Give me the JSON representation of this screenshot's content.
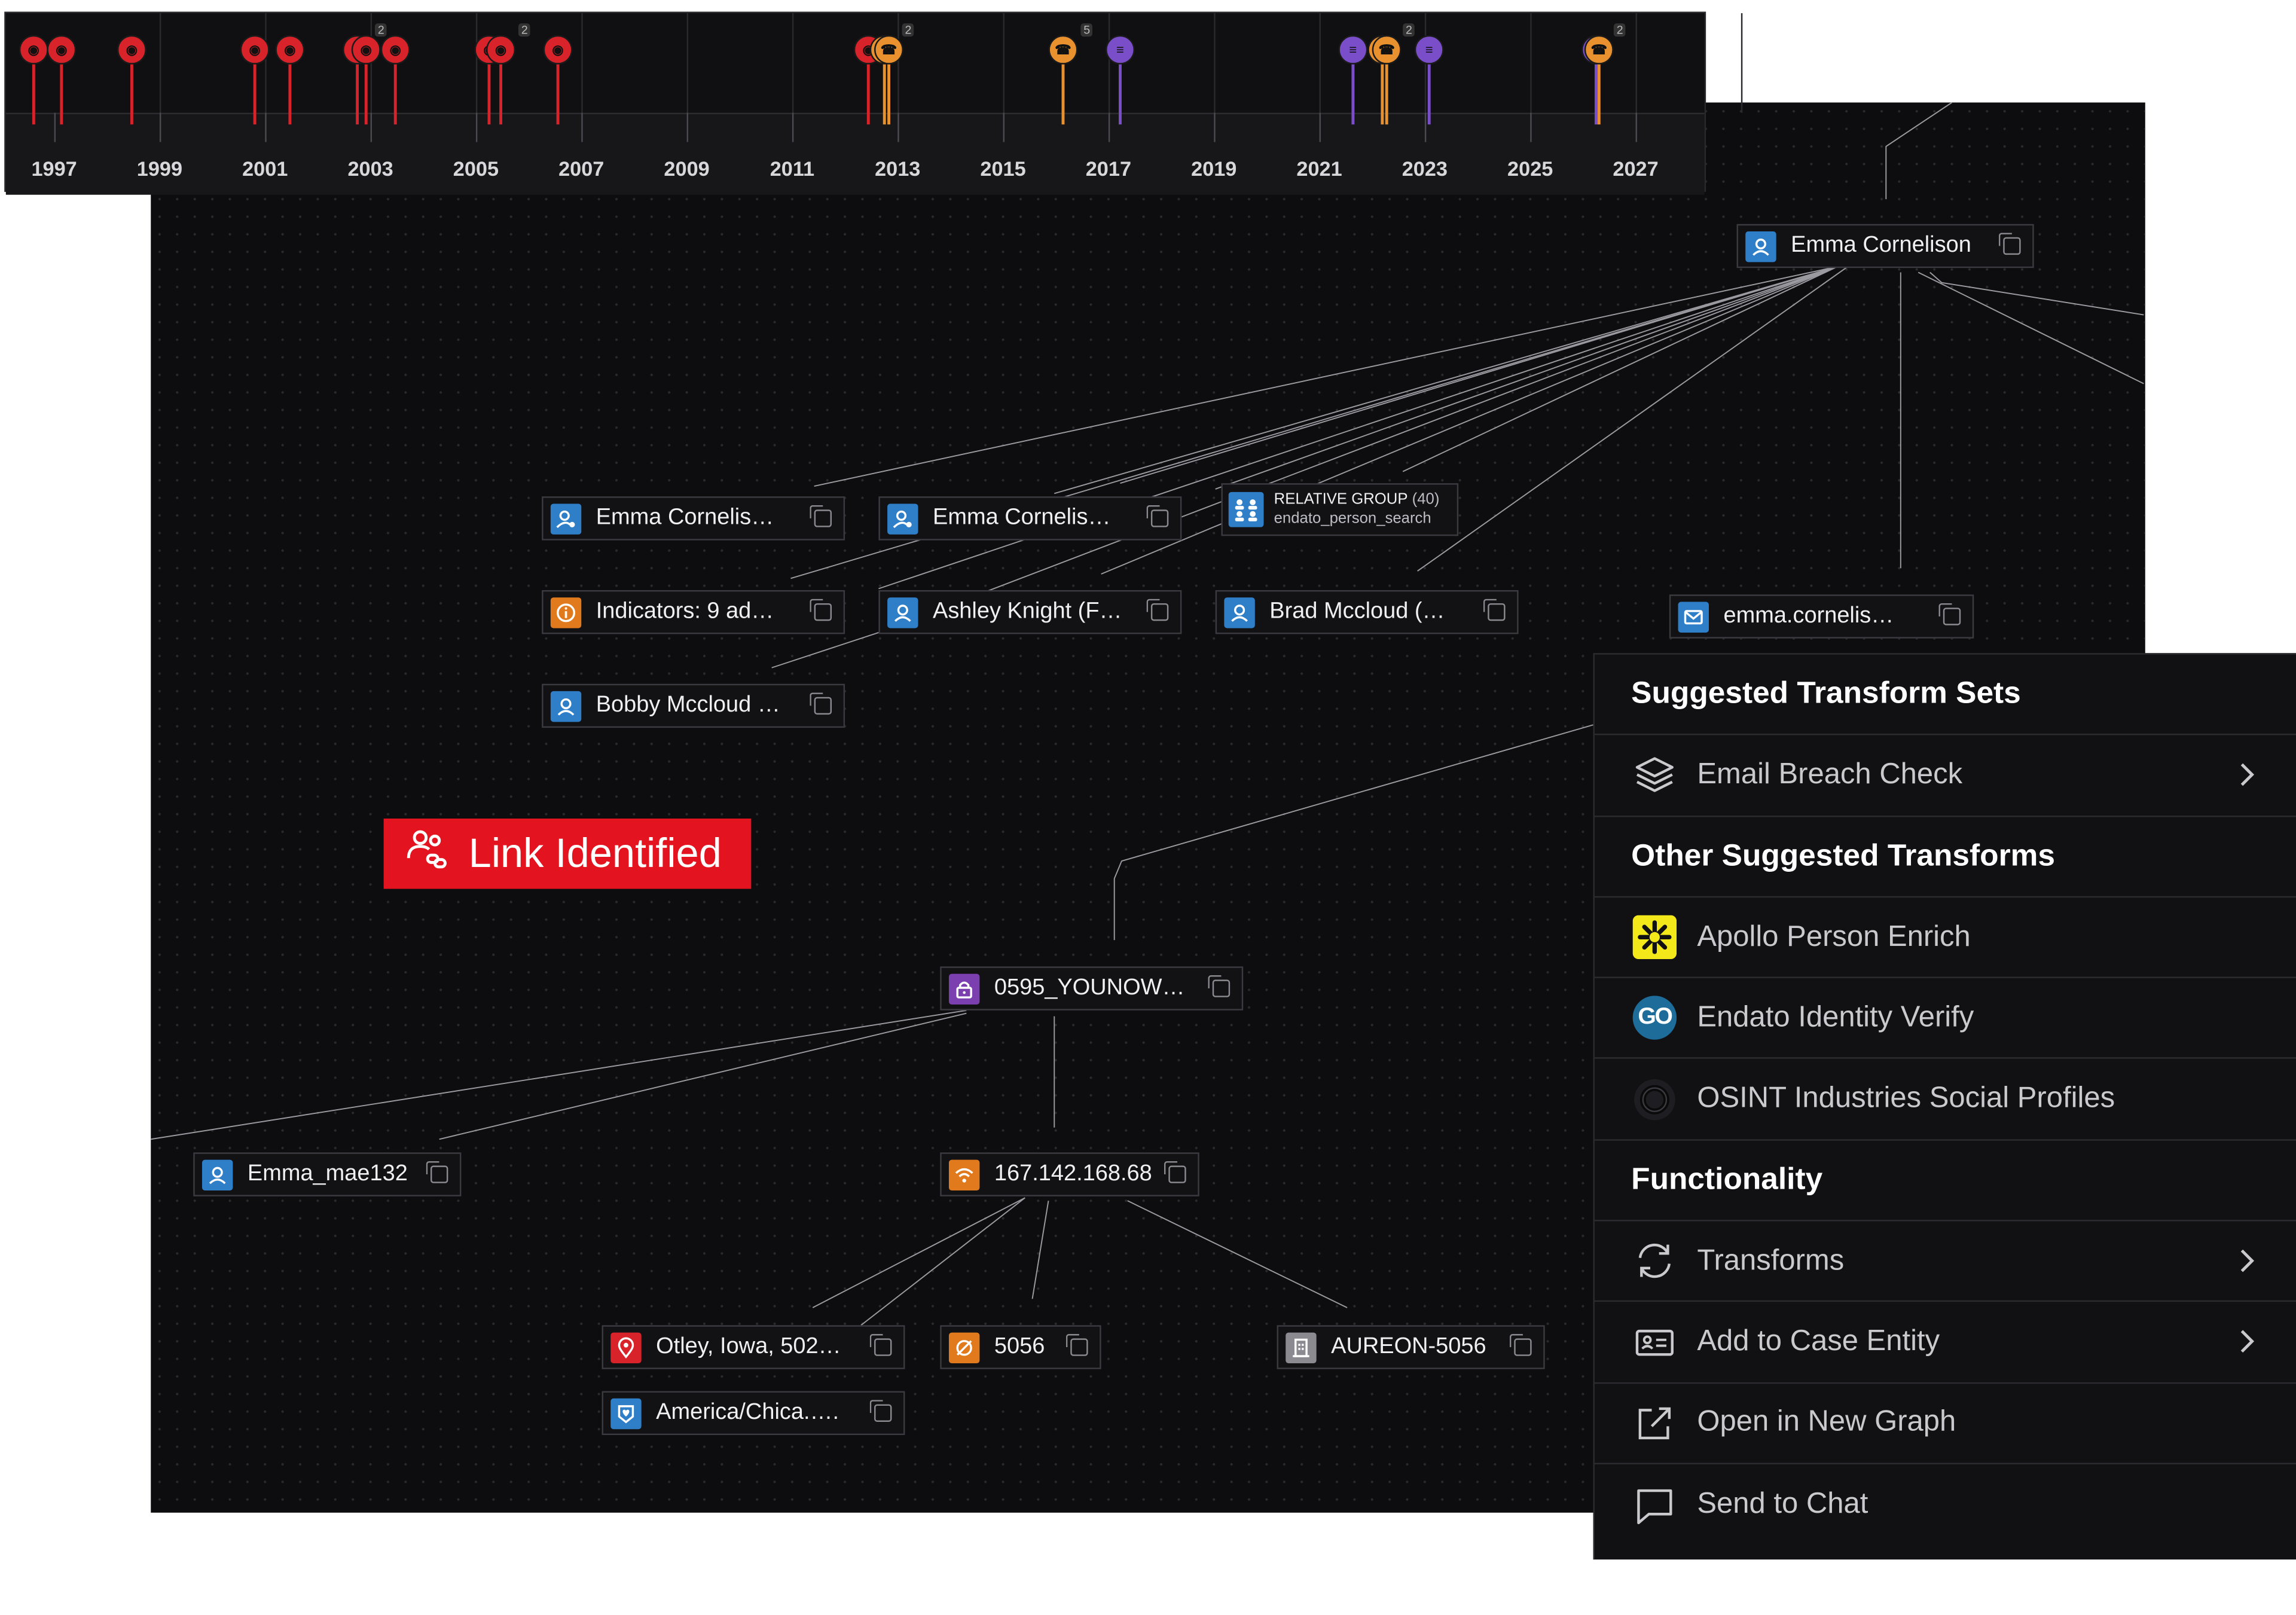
{
  "timeline": {
    "years": [
      "1997",
      "1999",
      "2001",
      "2003",
      "2005",
      "2007",
      "2009",
      "2011",
      "2013",
      "2015",
      "2017",
      "2019",
      "2021",
      "2023",
      "2025",
      "2027"
    ],
    "badges": [
      "2",
      "2",
      "2",
      "5",
      "2",
      "2"
    ]
  },
  "graph": {
    "root": "Emma Cornelison",
    "nodes": {
      "emma1": "Emma Cornelis…",
      "emma2": "Emma Cornelis…",
      "relative_title": "RELATIVE GROUP",
      "relative_count": "(40)",
      "relative_source": "endato_person_search",
      "indicators": "Indicators: 9 ad…",
      "ashley": "Ashley Knight (F…",
      "brad": "Brad Mccloud (…",
      "bobby": "Bobby Mccloud …",
      "email": "emma.cornelis…",
      "password": "0595_YOUNOW…",
      "username": "Emma_mae132",
      "ip": "167.142.168.68",
      "location": "Otley, Iowa, 502…",
      "timezone": "America/Chica.….",
      "asn": "5056",
      "org": "AUREON-5056"
    }
  },
  "link_badge": "Link Identified",
  "menu": {
    "h1": "Suggested Transform Sets",
    "email_breach": "Email Breach Check",
    "h2": "Other Suggested Transforms",
    "apollo": "Apollo Person Enrich",
    "endato": "Endato Identity Verify",
    "endato_logo": "GO",
    "osint": "OSINT Industries Social Profiles",
    "h3": "Functionality",
    "transforms": "Transforms",
    "add_case": "Add to Case Entity",
    "open_graph": "Open in New Graph",
    "send_chat": "Send to Chat"
  },
  "colors": {
    "person": "#2f7fc8",
    "indicator": "#e07a1c",
    "location": "#d8232a",
    "call": "#e8912e",
    "document": "#7a4ec9",
    "password": "#7b3fb0",
    "link_badge": "#e3141f"
  }
}
